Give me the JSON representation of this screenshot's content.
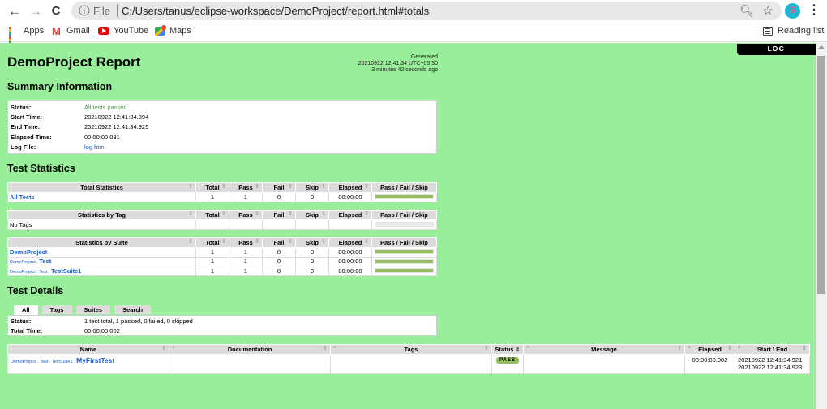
{
  "browser": {
    "nav": {
      "back": "←",
      "forward": "→",
      "reload": "C"
    },
    "address": {
      "scheme": "File",
      "url": "C:/Users/tanus/eclipse-workspace/DemoProject/report.html#totals"
    },
    "profile_initial": "S",
    "bookmarks": [
      {
        "label": "Apps",
        "icon": "apps-grid-icon"
      },
      {
        "label": "Gmail",
        "icon": "gmail-icon"
      },
      {
        "label": "YouTube",
        "icon": "youtube-icon"
      },
      {
        "label": "Maps",
        "icon": "maps-icon"
      }
    ],
    "reading_list": "Reading list"
  },
  "report": {
    "log_button": "LOG",
    "title": "DemoProject Report",
    "generated": {
      "label": "Generated",
      "timestamp": "20210922 12:41:34 UTC+05:30",
      "ago": "3 minutes 42 seconds ago"
    },
    "summary": {
      "heading": "Summary Information",
      "rows": [
        {
          "label": "Status:",
          "value": "All tests passed"
        },
        {
          "label": "Start Time:",
          "value": "20210922 12:41:34.894"
        },
        {
          "label": "End Time:",
          "value": "20210922 12:41:34.925"
        },
        {
          "label": "Elapsed Time:",
          "value": "00:00:00.031"
        },
        {
          "label": "Log File:",
          "value": "log.html"
        }
      ]
    },
    "statistics": {
      "heading": "Test Statistics",
      "columns": [
        "Total",
        "Pass",
        "Fail",
        "Skip",
        "Elapsed",
        "Pass / Fail / Skip"
      ],
      "total": {
        "title": "Total Statistics",
        "rows": [
          {
            "name": "All Tests",
            "total": "1",
            "pass": "1",
            "fail": "0",
            "skip": "0",
            "elapsed": "00:00:00",
            "pass_fraction": 1.0
          }
        ]
      },
      "tag": {
        "title": "Statistics by Tag",
        "rows": [
          {
            "name": "No Tags"
          }
        ]
      },
      "suite": {
        "title": "Statistics by Suite",
        "rows": [
          {
            "parent": "",
            "name": "DemoProject",
            "total": "1",
            "pass": "1",
            "fail": "0",
            "skip": "0",
            "elapsed": "00:00:00",
            "pass_fraction": 1.0
          },
          {
            "parent": "DemoProject . ",
            "name": "Test",
            "total": "1",
            "pass": "1",
            "fail": "0",
            "skip": "0",
            "elapsed": "00:00:00",
            "pass_fraction": 1.0
          },
          {
            "parent": "DemoProject . Test . ",
            "name": "TestSuite1",
            "total": "1",
            "pass": "1",
            "fail": "0",
            "skip": "0",
            "elapsed": "00:00:00",
            "pass_fraction": 1.0
          }
        ]
      }
    },
    "details": {
      "heading": "Test Details",
      "tabs": [
        "All",
        "Tags",
        "Suites",
        "Search"
      ],
      "active_tab": "All",
      "summary": [
        {
          "label": "Status:",
          "value": "1 test total, 1 passed, 0 failed, 0 skipped"
        },
        {
          "label": "Total Time:",
          "value": "00:00:00.002"
        }
      ],
      "columns": [
        "Name",
        "Documentation",
        "Tags",
        "Status",
        "Message",
        "Elapsed",
        "Start / End"
      ],
      "rows": [
        {
          "parent": "DemoProject . Test . TestSuite1 . ",
          "name": "MyFirstTest",
          "documentation": "",
          "tags": "",
          "status": "PASS",
          "message": "",
          "elapsed": "00:00:00.002",
          "start": "20210922 12:41:34.921",
          "end": "20210922 12:41:34.923"
        }
      ]
    }
  },
  "colors": {
    "page_bg": "#99ee99",
    "pass_bar": "#97bd61",
    "link": "#1b5dc9",
    "status_pass_text": "#33a433"
  }
}
